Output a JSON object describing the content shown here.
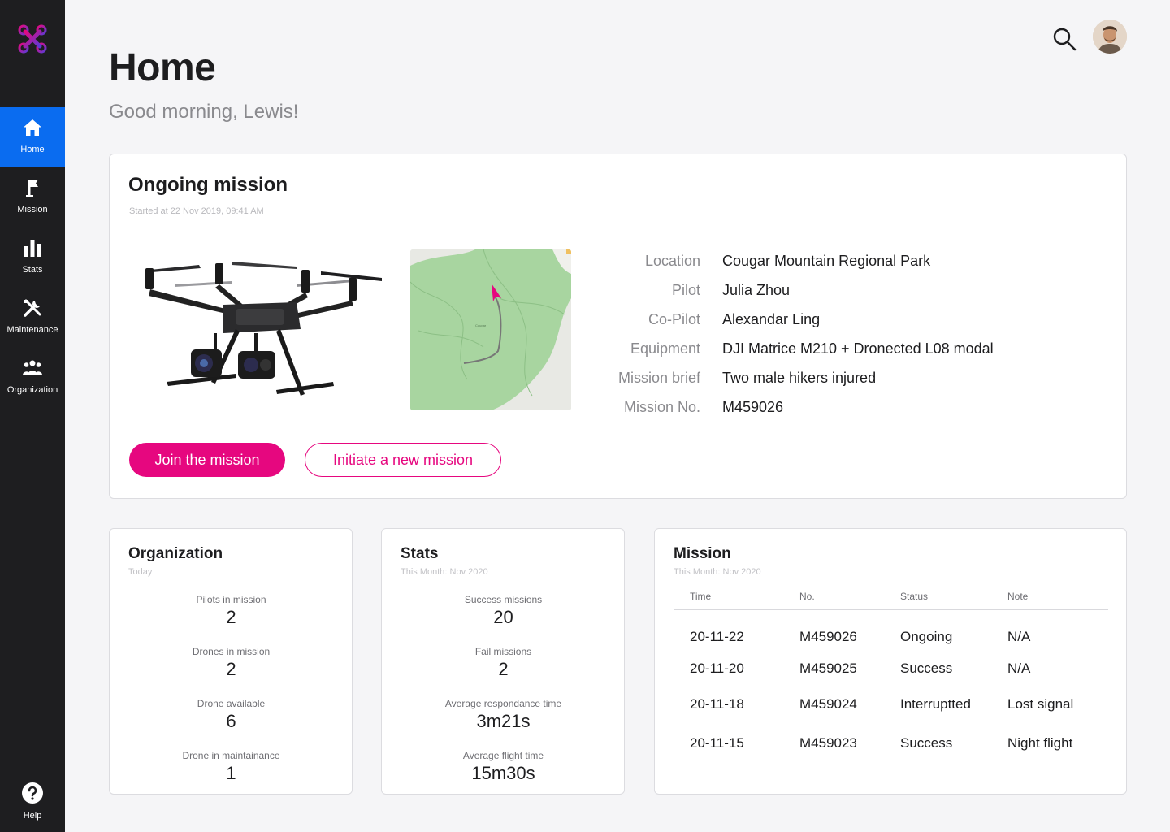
{
  "nav": {
    "items": [
      {
        "label": "Home",
        "icon": "home-icon",
        "active": true
      },
      {
        "label": "Mission",
        "icon": "flag-icon"
      },
      {
        "label": "Stats",
        "icon": "bar-chart-icon"
      },
      {
        "label": "Maintenance",
        "icon": "tools-icon"
      },
      {
        "label": "Organization",
        "icon": "people-icon"
      }
    ],
    "help": {
      "label": "Help",
      "icon": "help-icon"
    }
  },
  "header": {
    "title": "Home",
    "greeting": "Good morning, Lewis!"
  },
  "ongoing": {
    "title": "Ongoing mission",
    "started": "Started at 22 Nov 2019, 09:41 AM",
    "details": [
      {
        "label": "Location",
        "value": "Cougar Mountain Regional Park"
      },
      {
        "label": "Pilot",
        "value": "Julia Zhou"
      },
      {
        "label": "Co-Pilot",
        "value": "Alexandar Ling"
      },
      {
        "label": "Equipment",
        "value": "DJI Matrice M210 + Dronected L08 modal"
      },
      {
        "label": "Mission brief",
        "value": "Two male hikers injured"
      },
      {
        "label": "Mission No.",
        "value": "M459026"
      }
    ],
    "join_label": "Join the mission",
    "new_label": "Initiate a new mission"
  },
  "organization": {
    "title": "Organization",
    "sub": "Today",
    "metrics": [
      {
        "label": "Pilots in mission",
        "value": "2"
      },
      {
        "label": "Drones in mission",
        "value": "2"
      },
      {
        "label": "Drone available",
        "value": "6"
      },
      {
        "label": "Drone in maintainance",
        "value": "1"
      }
    ]
  },
  "stats": {
    "title": "Stats",
    "sub": "This Month: Nov 2020",
    "metrics": [
      {
        "label": "Success missions",
        "value": "20"
      },
      {
        "label": "Fail missions",
        "value": "2"
      },
      {
        "label": "Average respondance time",
        "value": "3m21s"
      },
      {
        "label": "Average flight time",
        "value": "15m30s"
      }
    ]
  },
  "mission": {
    "title": "Mission",
    "sub": "This Month: Nov 2020",
    "columns": [
      "Time",
      "No.",
      "Status",
      "Note"
    ],
    "rows": [
      [
        "20-11-22",
        "M459026",
        "Ongoing",
        "N/A"
      ],
      [
        "20-11-20",
        "M459025",
        "Success",
        "N/A"
      ],
      [
        "20-11-18",
        "M459024",
        "Interruptted",
        "Lost signal"
      ],
      [
        "20-11-15",
        "M459023",
        "Success",
        "Night flight"
      ]
    ]
  },
  "colors": {
    "accent": "#e6077f",
    "nav_active": "#0a6cf0",
    "sidebar": "#1e1e20"
  }
}
